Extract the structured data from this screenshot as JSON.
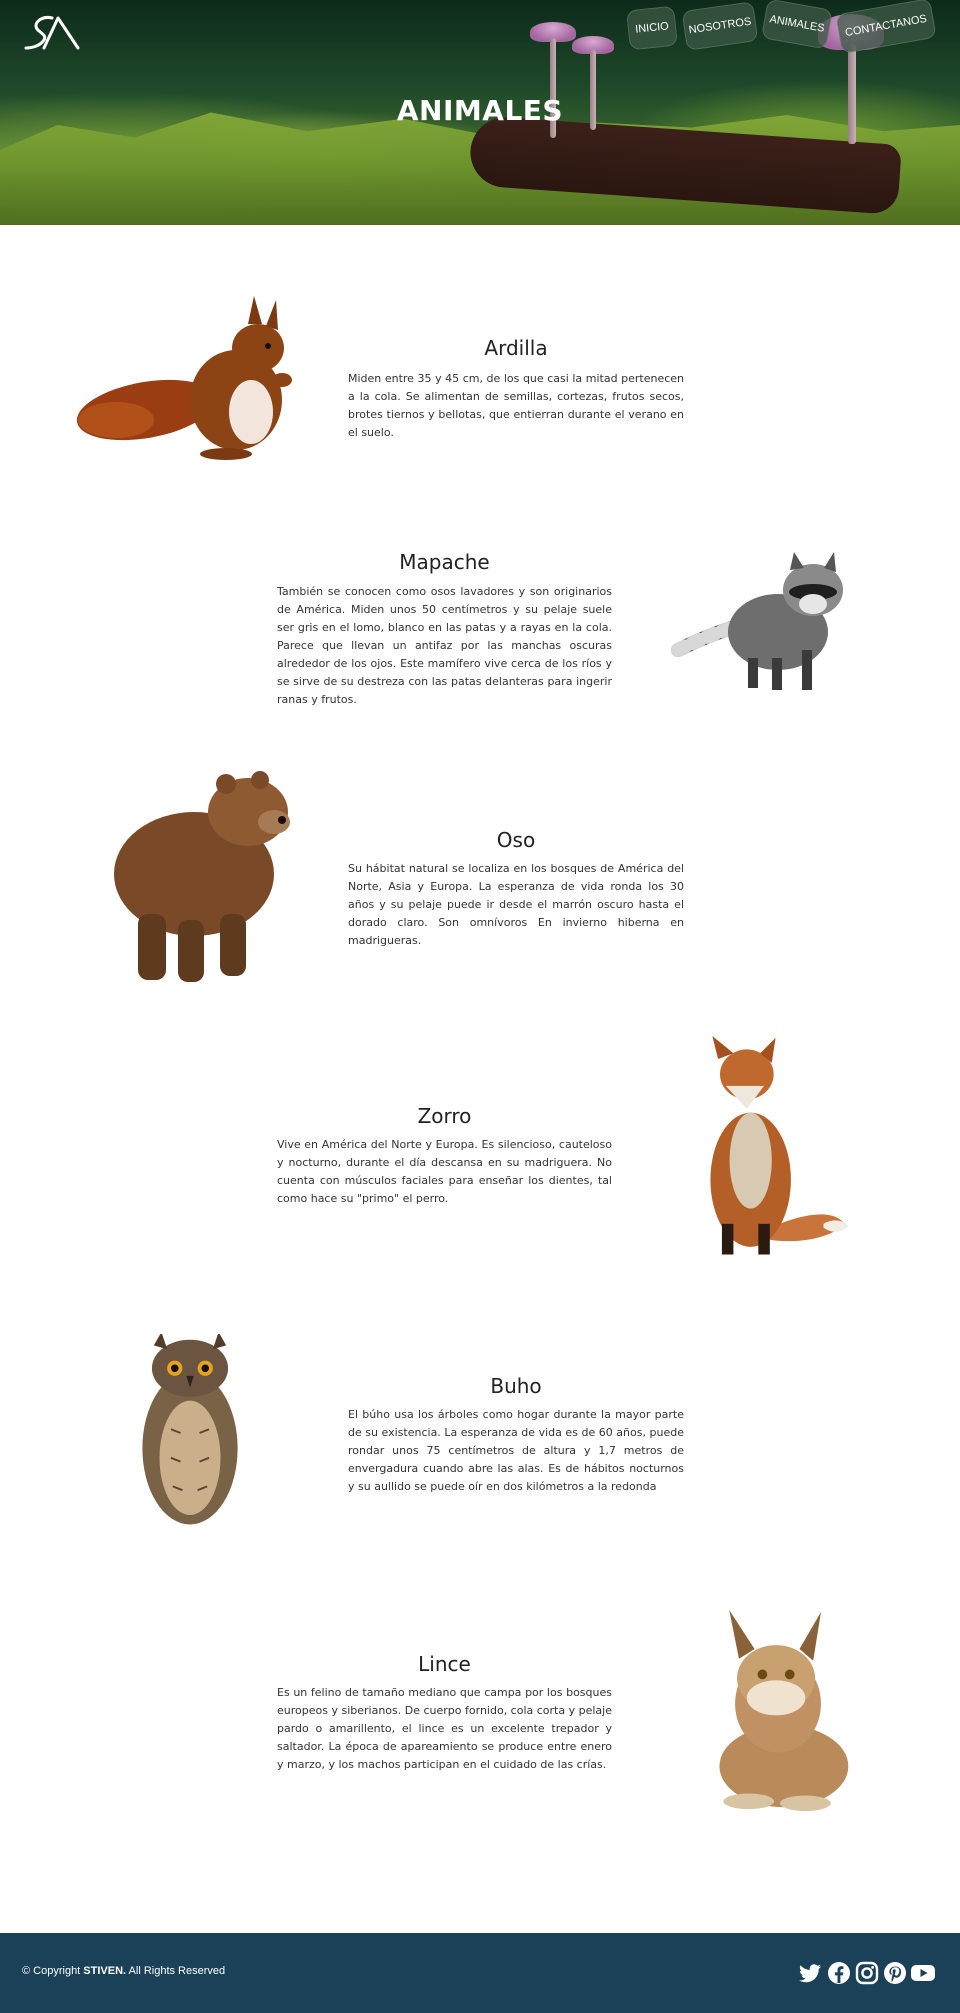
{
  "hero": {
    "title": "ANIMALES"
  },
  "nav": {
    "items": [
      {
        "label": "INICIO"
      },
      {
        "label": "NOSOTROS"
      },
      {
        "label": "ANIMALES"
      },
      {
        "label": "CONTACTANOS"
      }
    ]
  },
  "animals": [
    {
      "name": "Ardilla",
      "description": "Miden entre 35 y 45 cm, de los que casi la mitad pertenecen a la cola. Se alimentan de semillas, cortezas, frutos secos, brotes tiernos y bellotas, que entierran durante el verano en el suelo."
    },
    {
      "name": "Mapache",
      "description": "También se conocen como osos lavadores y son originarios de América. Miden unos 50 centímetros y su pelaje suele ser gris en el lomo, blanco en las patas y a rayas en la cola. Parece que llevan un antifaz por las manchas oscuras alrededor de los ojos. Este mamífero vive cerca de los ríos y se sirve de su destreza con las patas delanteras para ingerir ranas y frutos."
    },
    {
      "name": "Oso",
      "description": "Su hábitat natural se localiza en los bosques de América del Norte, Asia y Europa. La esperanza de vida ronda los 30 años y su pelaje puede ir desde el marrón oscuro hasta el dorado claro. Son omnívoros En invierno hiberna en madrigueras."
    },
    {
      "name": "Zorro",
      "description": "Vive en América del Norte y Europa. Es silencioso, cauteloso y nocturno, durante el día descansa en su madriguera. No cuenta con músculos faciales para enseñar los dientes, tal como hace su \"primo\" el perro."
    },
    {
      "name": "Buho",
      "description": "El búho usa los árboles como hogar durante la mayor parte de su existencia. La esperanza de vida es de 60 años, puede rondar unos 75 centímetros de altura y 1,7 metros de envergadura cuando abre las alas. Es de hábitos nocturnos y su aullido se puede oír en dos kilómetros a la redonda"
    },
    {
      "name": "Lince",
      "description": "Es un felino de tamaño mediano que campa por los bosques europeos y siberianos. De cuerpo fornido, cola corta y pelaje pardo o amarillento, el lince es un excelente trepador y saltador. La época de apareamiento se produce entre enero y marzo, y los machos participan en el cuidado de las crías."
    }
  ],
  "footer": {
    "copyright_prefix": "© Copyright ",
    "copyright_name": "STIVEN.",
    "copyright_suffix": " All Rights Reserved",
    "social_icons": [
      "twitter-icon",
      "facebook-icon",
      "instagram-icon",
      "pinterest-icon",
      "youtube-icon"
    ],
    "background": "#1b4159"
  }
}
